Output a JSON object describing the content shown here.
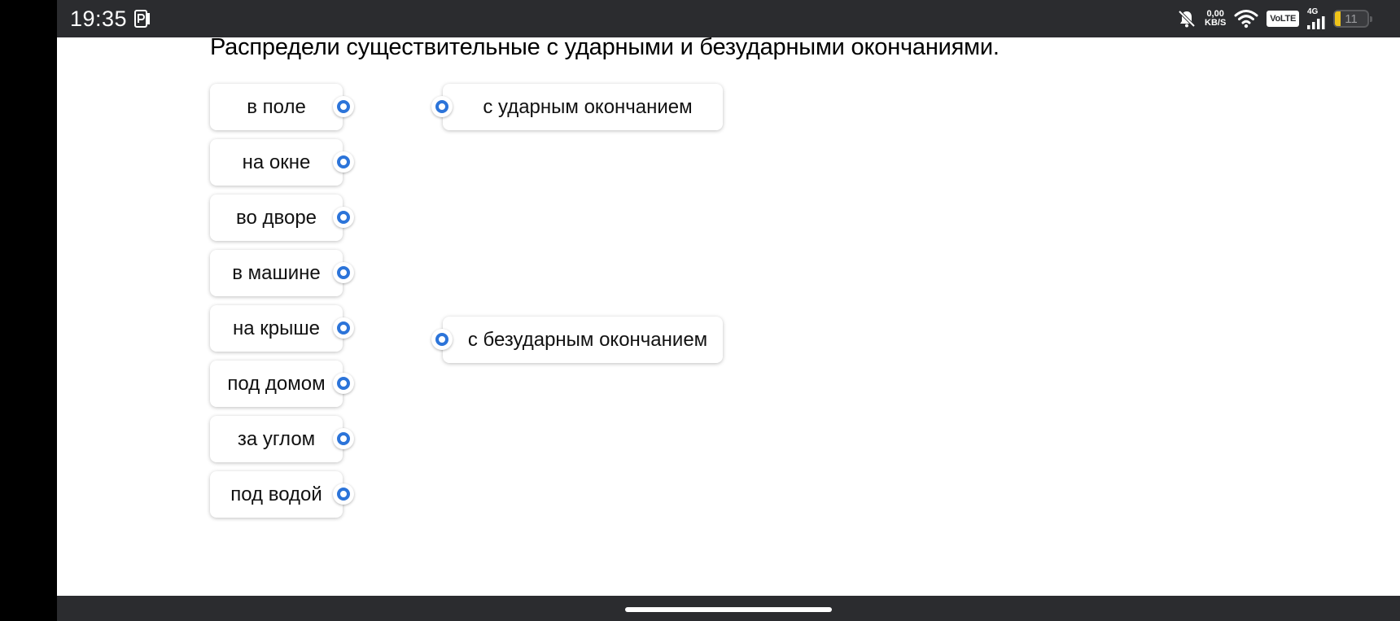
{
  "status_bar": {
    "time": "19:35",
    "net_speed_value": "0,00",
    "net_speed_unit": "KB/S",
    "volte": "VoLTE",
    "network": "4G",
    "battery_level": "11",
    "icons": [
      "p-notification-icon",
      "bell-off-icon",
      "wifi-icon",
      "signal-icon",
      "battery-icon"
    ]
  },
  "task": {
    "title": "Распредели существительные с ударными и безударными окончаниями.",
    "items": [
      "в поле",
      "на окне",
      "во дворе",
      "в машине",
      "на крыше",
      "под домом",
      "за углом",
      "под водой"
    ],
    "targets": [
      "с ударным окончанием",
      "с безударным окончанием"
    ]
  },
  "colors": {
    "accent": "#2c74d9",
    "system_bar": "#2b2c2f",
    "battery_low": "#f0c419"
  }
}
